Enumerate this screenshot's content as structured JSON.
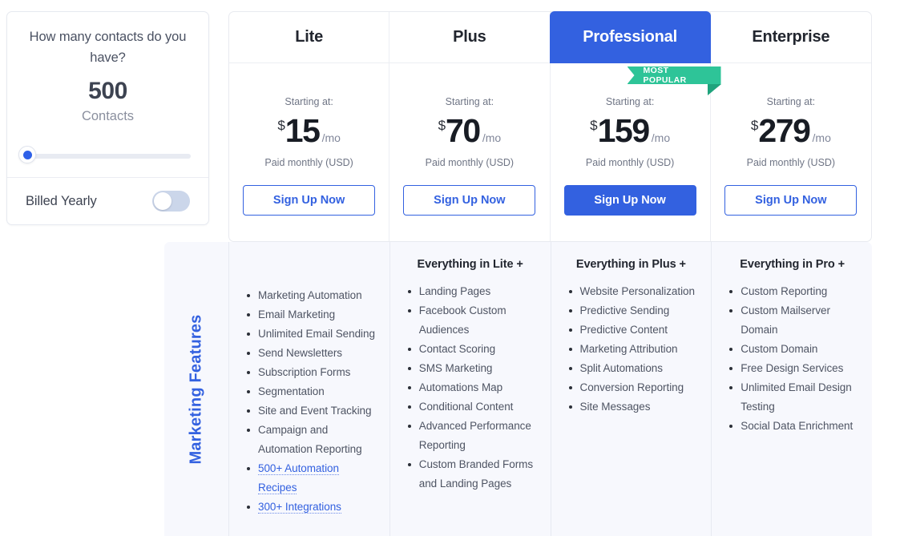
{
  "calculator": {
    "question": "How many contacts do you have?",
    "count": "500",
    "count_label": "Contacts",
    "slider_value": "500",
    "billing_label": "Billed Yearly",
    "billing_toggle_state": "off"
  },
  "colors": {
    "brand_blue": "#3361e0",
    "ribbon_green": "#2ec498",
    "ribbon_green_dark": "#1fa37c",
    "panel_background": "#f7f8fd",
    "text_dark": "#22262f",
    "text_muted": "#6f7585"
  },
  "plans": [
    {
      "name": "Lite",
      "starting_at": "Starting at:",
      "currency": "$",
      "amount": "15",
      "per": "/mo",
      "paid_note": "Paid monthly (USD)",
      "cta": "Sign Up Now",
      "featured": false
    },
    {
      "name": "Plus",
      "starting_at": "Starting at:",
      "currency": "$",
      "amount": "70",
      "per": "/mo",
      "paid_note": "Paid monthly (USD)",
      "cta": "Sign Up Now",
      "featured": false
    },
    {
      "name": "Professional",
      "starting_at": "Starting at:",
      "currency": "$",
      "amount": "159",
      "per": "/mo",
      "paid_note": "Paid monthly (USD)",
      "cta": "Sign Up Now",
      "featured": true,
      "badge": "MOST POPULAR"
    },
    {
      "name": "Enterprise",
      "starting_at": "Starting at:",
      "currency": "$",
      "amount": "279",
      "per": "/mo",
      "paid_note": "Paid monthly (USD)",
      "cta": "Sign Up Now",
      "featured": false
    }
  ],
  "features": {
    "section_label": "Marketing Features",
    "columns": [
      {
        "title": "",
        "items": [
          {
            "text": "Marketing Automation",
            "link": false
          },
          {
            "text": "Email Marketing",
            "link": false
          },
          {
            "text": "Unlimited Email Sending",
            "link": false
          },
          {
            "text": "Send Newsletters",
            "link": false
          },
          {
            "text": "Subscription Forms",
            "link": false
          },
          {
            "text": "Segmentation",
            "link": false
          },
          {
            "text": "Site and Event Tracking",
            "link": false
          },
          {
            "text": "Campaign and Automation Reporting",
            "link": false
          },
          {
            "text": "500+ Automation Recipes",
            "link": true
          },
          {
            "text": "300+ Integrations",
            "link": true
          }
        ]
      },
      {
        "title": "Everything in Lite +",
        "items": [
          {
            "text": "Landing Pages",
            "link": false
          },
          {
            "text": "Facebook Custom Audiences",
            "link": false
          },
          {
            "text": "Contact Scoring",
            "link": false
          },
          {
            "text": "SMS Marketing",
            "link": false
          },
          {
            "text": "Automations Map",
            "link": false
          },
          {
            "text": "Conditional Content",
            "link": false
          },
          {
            "text": "Advanced Performance Reporting",
            "link": false
          },
          {
            "text": "Custom Branded Forms and Landing Pages",
            "link": false
          }
        ]
      },
      {
        "title": "Everything in Plus +",
        "items": [
          {
            "text": "Website Personalization",
            "link": false
          },
          {
            "text": "Predictive Sending",
            "link": false
          },
          {
            "text": "Predictive Content",
            "link": false
          },
          {
            "text": "Marketing Attribution",
            "link": false
          },
          {
            "text": "Split Automations",
            "link": false
          },
          {
            "text": "Conversion Reporting",
            "link": false
          },
          {
            "text": "Site Messages",
            "link": false
          }
        ]
      },
      {
        "title": "Everything in Pro +",
        "items": [
          {
            "text": "Custom Reporting",
            "link": false
          },
          {
            "text": "Custom Mailserver Domain",
            "link": false
          },
          {
            "text": "Custom Domain",
            "link": false
          },
          {
            "text": "Free Design Services",
            "link": false
          },
          {
            "text": "Unlimited Email Design Testing",
            "link": false
          },
          {
            "text": "Social Data Enrichment",
            "link": false
          }
        ]
      }
    ]
  }
}
